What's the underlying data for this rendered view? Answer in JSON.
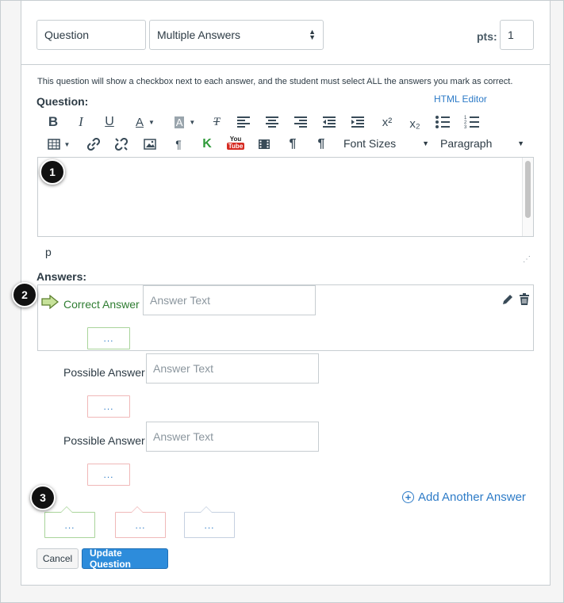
{
  "header": {
    "question_name": "Question",
    "question_type": "Multiple Answers",
    "pts_label": "pts:",
    "pts_value": "1"
  },
  "instructions": "This question will show a checkbox next to each answer, and the student must select ALL the answers you mark as correct.",
  "question_label": "Question:",
  "html_editor_link": "HTML Editor",
  "toolbar": {
    "font_sizes": "Font Sizes",
    "paragraph": "Paragraph",
    "superscript": "x²",
    "subscript": "x₂",
    "youtube_top": "You",
    "youtube_bottom": "Tube"
  },
  "editor_path": "p",
  "answers_label": "Answers:",
  "answers": [
    {
      "label": "Correct Answer",
      "placeholder": "Answer Text",
      "comment": "..."
    },
    {
      "label": "Possible Answer",
      "placeholder": "Answer Text",
      "comment": "..."
    },
    {
      "label": "Possible Answer",
      "placeholder": "Answer Text",
      "comment": "..."
    }
  ],
  "general_comments": [
    "...",
    "...",
    "..."
  ],
  "add_answer": "Add Another Answer",
  "buttons": {
    "cancel": "Cancel",
    "update": "Update Question"
  },
  "callouts": [
    "1",
    "2",
    "3"
  ],
  "colors": {
    "accent": "#2d7bc7",
    "primary_button": "#2d8cdb",
    "correct_green": "#2f7d32",
    "correct_border": "#a9d49a",
    "incorrect_border": "#f0b8b8",
    "neutral_border": "#c5d0e0"
  }
}
